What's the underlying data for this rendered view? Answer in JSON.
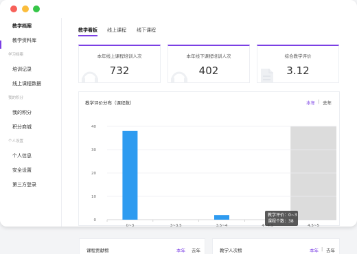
{
  "sidebar": {
    "items": [
      {
        "label": "教学档案",
        "active": true
      },
      {
        "label": "教学资料库"
      },
      {
        "label": "培训记录"
      },
      {
        "label": "线上课程数据"
      },
      {
        "label": "我的积分"
      },
      {
        "label": "积分商城"
      },
      {
        "label": "个人信息"
      },
      {
        "label": "安全设置"
      },
      {
        "label": "第三方登录"
      }
    ],
    "groups": [
      "学习档案",
      "我的积分",
      "个人设置"
    ]
  },
  "tabs": [
    "教学看板",
    "线上课程",
    "线下课程"
  ],
  "stats": [
    {
      "label": "本年线上课程培训人次",
      "value": "732",
      "icon": "headset-icon"
    },
    {
      "label": "本年线下课程培训人次",
      "value": "402",
      "icon": "headset-icon"
    },
    {
      "label": "综合教学评价",
      "value": "3.12",
      "icon": "document-icon"
    }
  ],
  "chart_card": {
    "title": "教学评价分布（课程数）",
    "year_current": "本年",
    "year_separator": "|",
    "year_last": "去年"
  },
  "chart_data": {
    "type": "bar",
    "title": "教学评价分布（课程数）",
    "categories": [
      "0~3",
      "3~3.5",
      "3.5~4",
      "4~4.5",
      "4.5~5"
    ],
    "values": [
      38,
      0,
      2,
      0,
      0
    ],
    "ylim": [
      0,
      40
    ],
    "yticks": [
      0,
      10,
      20,
      30,
      40
    ],
    "bar_color": "#2e9bf0",
    "highlight_category": "4.5~5",
    "highlight_color": "#dcdcdc",
    "grid": true
  },
  "tooltip": {
    "line1": "教学评价：0~3",
    "line2": "课程个数：38"
  },
  "bottom_cards": [
    {
      "title": "课程贡献榜",
      "year_current": "本年",
      "year_last": "去年"
    },
    {
      "title": "教学人次榜",
      "year_current": "本年",
      "year_separator": "|",
      "year_last": "去年"
    }
  ],
  "colors": {
    "accent": "#7b3fe4",
    "bar": "#2e9bf0"
  }
}
